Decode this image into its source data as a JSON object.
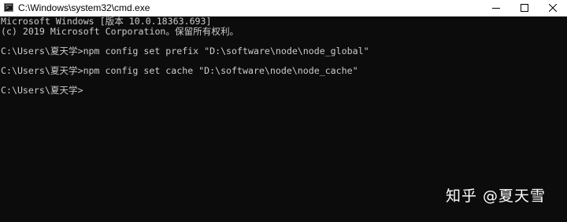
{
  "window": {
    "title": "C:\\Windows\\system32\\cmd.exe",
    "icon": "cmd-icon",
    "controls": {
      "minimize": "minimize-icon",
      "maximize": "maximize-icon",
      "close": "close-icon"
    }
  },
  "console": {
    "lines": [
      "Microsoft Windows [版本 10.0.18363.693]",
      "(c) 2019 Microsoft Corporation。保留所有权利。",
      "C:\\Users\\夏天学>npm config set prefix \"D:\\software\\node\\node_global\"",
      "C:\\Users\\夏天学>npm config set cache \"D:\\software\\node\\node_cache\"",
      "C:\\Users\\夏天学>"
    ],
    "colors": {
      "background": "#0c0c0c",
      "foreground": "#cccccc"
    }
  },
  "watermark": {
    "text": "知乎 @夏天雪"
  }
}
